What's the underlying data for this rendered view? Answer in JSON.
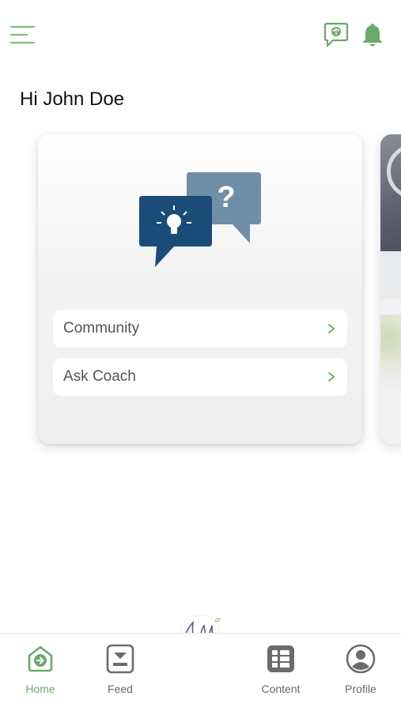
{
  "header": {
    "menu_icon": "hamburger-menu-icon",
    "chat_icon": "chat-bubble-icon",
    "bell_icon": "notification-bell-icon"
  },
  "greeting": "Hi John Doe",
  "card": {
    "illustration_icon": "speech-bubbles-idea-question-icon",
    "items": [
      {
        "label": "Community",
        "chevron": "›"
      },
      {
        "label": "Ask Coach",
        "chevron": "›"
      }
    ]
  },
  "nav": {
    "items": [
      {
        "label": "Home",
        "icon": "home-icon",
        "active": true
      },
      {
        "label": "Feed",
        "icon": "feed-icon",
        "active": false
      },
      {
        "label": "Content",
        "icon": "content-grid-icon",
        "active": false
      },
      {
        "label": "Profile",
        "icon": "profile-icon",
        "active": false
      }
    ],
    "center_logo": "signature-logo-icon"
  },
  "colors": {
    "accent_green": "#6aab6a",
    "dark_blue": "#1f4e79",
    "light_blue": "#6f8fa8",
    "nav_gray": "#6b6b6b"
  }
}
